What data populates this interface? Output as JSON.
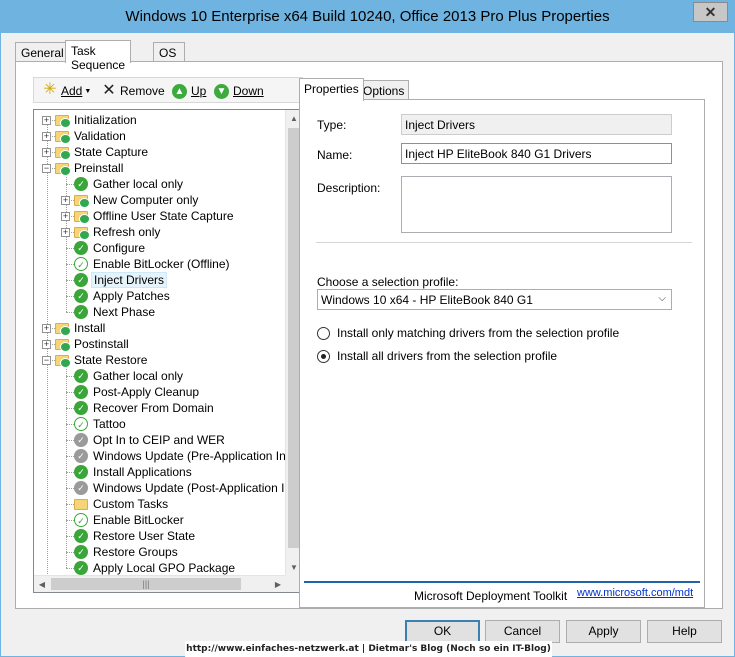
{
  "window": {
    "title": "Windows 10 Enterprise x64 Build 10240, Office 2013 Pro Plus Properties",
    "close_label": "✕"
  },
  "outer_tabs": [
    {
      "label": "General",
      "active": false
    },
    {
      "label": "Task Sequence",
      "active": true
    },
    {
      "label": "OS Info",
      "active": false
    }
  ],
  "toolbar": {
    "add_label": "Add",
    "remove_label": "Remove",
    "up_label": "Up",
    "down_label": "Down",
    "add_icon": "starburst-icon",
    "remove_icon": "x-icon",
    "up_icon": "green-arrow-up-icon",
    "down_icon": "green-arrow-down-icon"
  },
  "tree": {
    "items": [
      {
        "label": "Initialization",
        "level": 0,
        "type": "group",
        "expander": "+"
      },
      {
        "label": "Validation",
        "level": 0,
        "type": "group",
        "expander": "+"
      },
      {
        "label": "State Capture",
        "level": 0,
        "type": "group",
        "expander": "+"
      },
      {
        "label": "Preinstall",
        "level": 0,
        "type": "group",
        "expander": "-"
      },
      {
        "label": "Gather local only",
        "level": 1,
        "type": "step"
      },
      {
        "label": "New Computer only",
        "level": 1,
        "type": "group",
        "expander": "+"
      },
      {
        "label": "Offline User State Capture",
        "level": 1,
        "type": "group",
        "expander": "+"
      },
      {
        "label": "Refresh only",
        "level": 1,
        "type": "group",
        "expander": "+"
      },
      {
        "label": "Configure",
        "level": 1,
        "type": "step"
      },
      {
        "label": "Enable BitLocker (Offline)",
        "level": 1,
        "type": "step-empty"
      },
      {
        "label": "Inject Drivers",
        "level": 1,
        "type": "step",
        "selected": true
      },
      {
        "label": "Apply Patches",
        "level": 1,
        "type": "step"
      },
      {
        "label": "Next Phase",
        "level": 1,
        "type": "step"
      },
      {
        "label": "Install",
        "level": 0,
        "type": "group",
        "expander": "+"
      },
      {
        "label": "Postinstall",
        "level": 0,
        "type": "group",
        "expander": "+"
      },
      {
        "label": "State Restore",
        "level": 0,
        "type": "group",
        "expander": "-"
      },
      {
        "label": "Gather local only",
        "level": 1,
        "type": "step"
      },
      {
        "label": "Post-Apply Cleanup",
        "level": 1,
        "type": "step"
      },
      {
        "label": "Recover From Domain",
        "level": 1,
        "type": "step"
      },
      {
        "label": "Tattoo",
        "level": 1,
        "type": "step-empty"
      },
      {
        "label": "Opt In to CEIP and WER",
        "level": 1,
        "type": "step-grey"
      },
      {
        "label": "Windows Update (Pre-Application Inst",
        "level": 1,
        "type": "step-grey"
      },
      {
        "label": "Install Applications",
        "level": 1,
        "type": "step"
      },
      {
        "label": "Windows Update (Post-Application Ins",
        "level": 1,
        "type": "step-grey"
      },
      {
        "label": "Custom Tasks",
        "level": 1,
        "type": "folder-plain"
      },
      {
        "label": "Enable BitLocker",
        "level": 1,
        "type": "step-empty"
      },
      {
        "label": "Restore User State",
        "level": 1,
        "type": "step"
      },
      {
        "label": "Restore Groups",
        "level": 1,
        "type": "step"
      },
      {
        "label": "Apply Local GPO Package",
        "level": 1,
        "type": "step"
      }
    ],
    "hscroll_grip": "|||"
  },
  "inner_tabs": [
    {
      "label": "Properties",
      "active": true
    },
    {
      "label": "Options",
      "active": false
    }
  ],
  "properties": {
    "type_label": "Type:",
    "type_value": "Inject Drivers",
    "name_label": "Name:",
    "name_value": "Inject HP EliteBook 840 G1 Drivers",
    "description_label": "Description:",
    "description_value": "",
    "profile_label": "Choose a selection profile:",
    "profile_value": "Windows 10 x64 - HP EliteBook 840 G1",
    "radio_matching": "Install only matching drivers from the selection profile",
    "radio_all": "Install all drivers from the selection profile",
    "radio_selected": "all"
  },
  "footer": {
    "mdt_text": "Microsoft Deployment Toolkit",
    "mdt_link": "www.microsoft.com/mdt"
  },
  "buttons": {
    "ok": "OK",
    "cancel": "Cancel",
    "apply": "Apply",
    "help": "Help"
  },
  "watermark": "http://www.einfaches-netzwerk.at | Dietmar's Blog (Noch so ein IT-Blog)",
  "colors": {
    "titlebar": "#6fb3e0",
    "step_ok": "#3aa63a",
    "mdt_rule": "#1f63a8",
    "link": "#0033cc"
  }
}
